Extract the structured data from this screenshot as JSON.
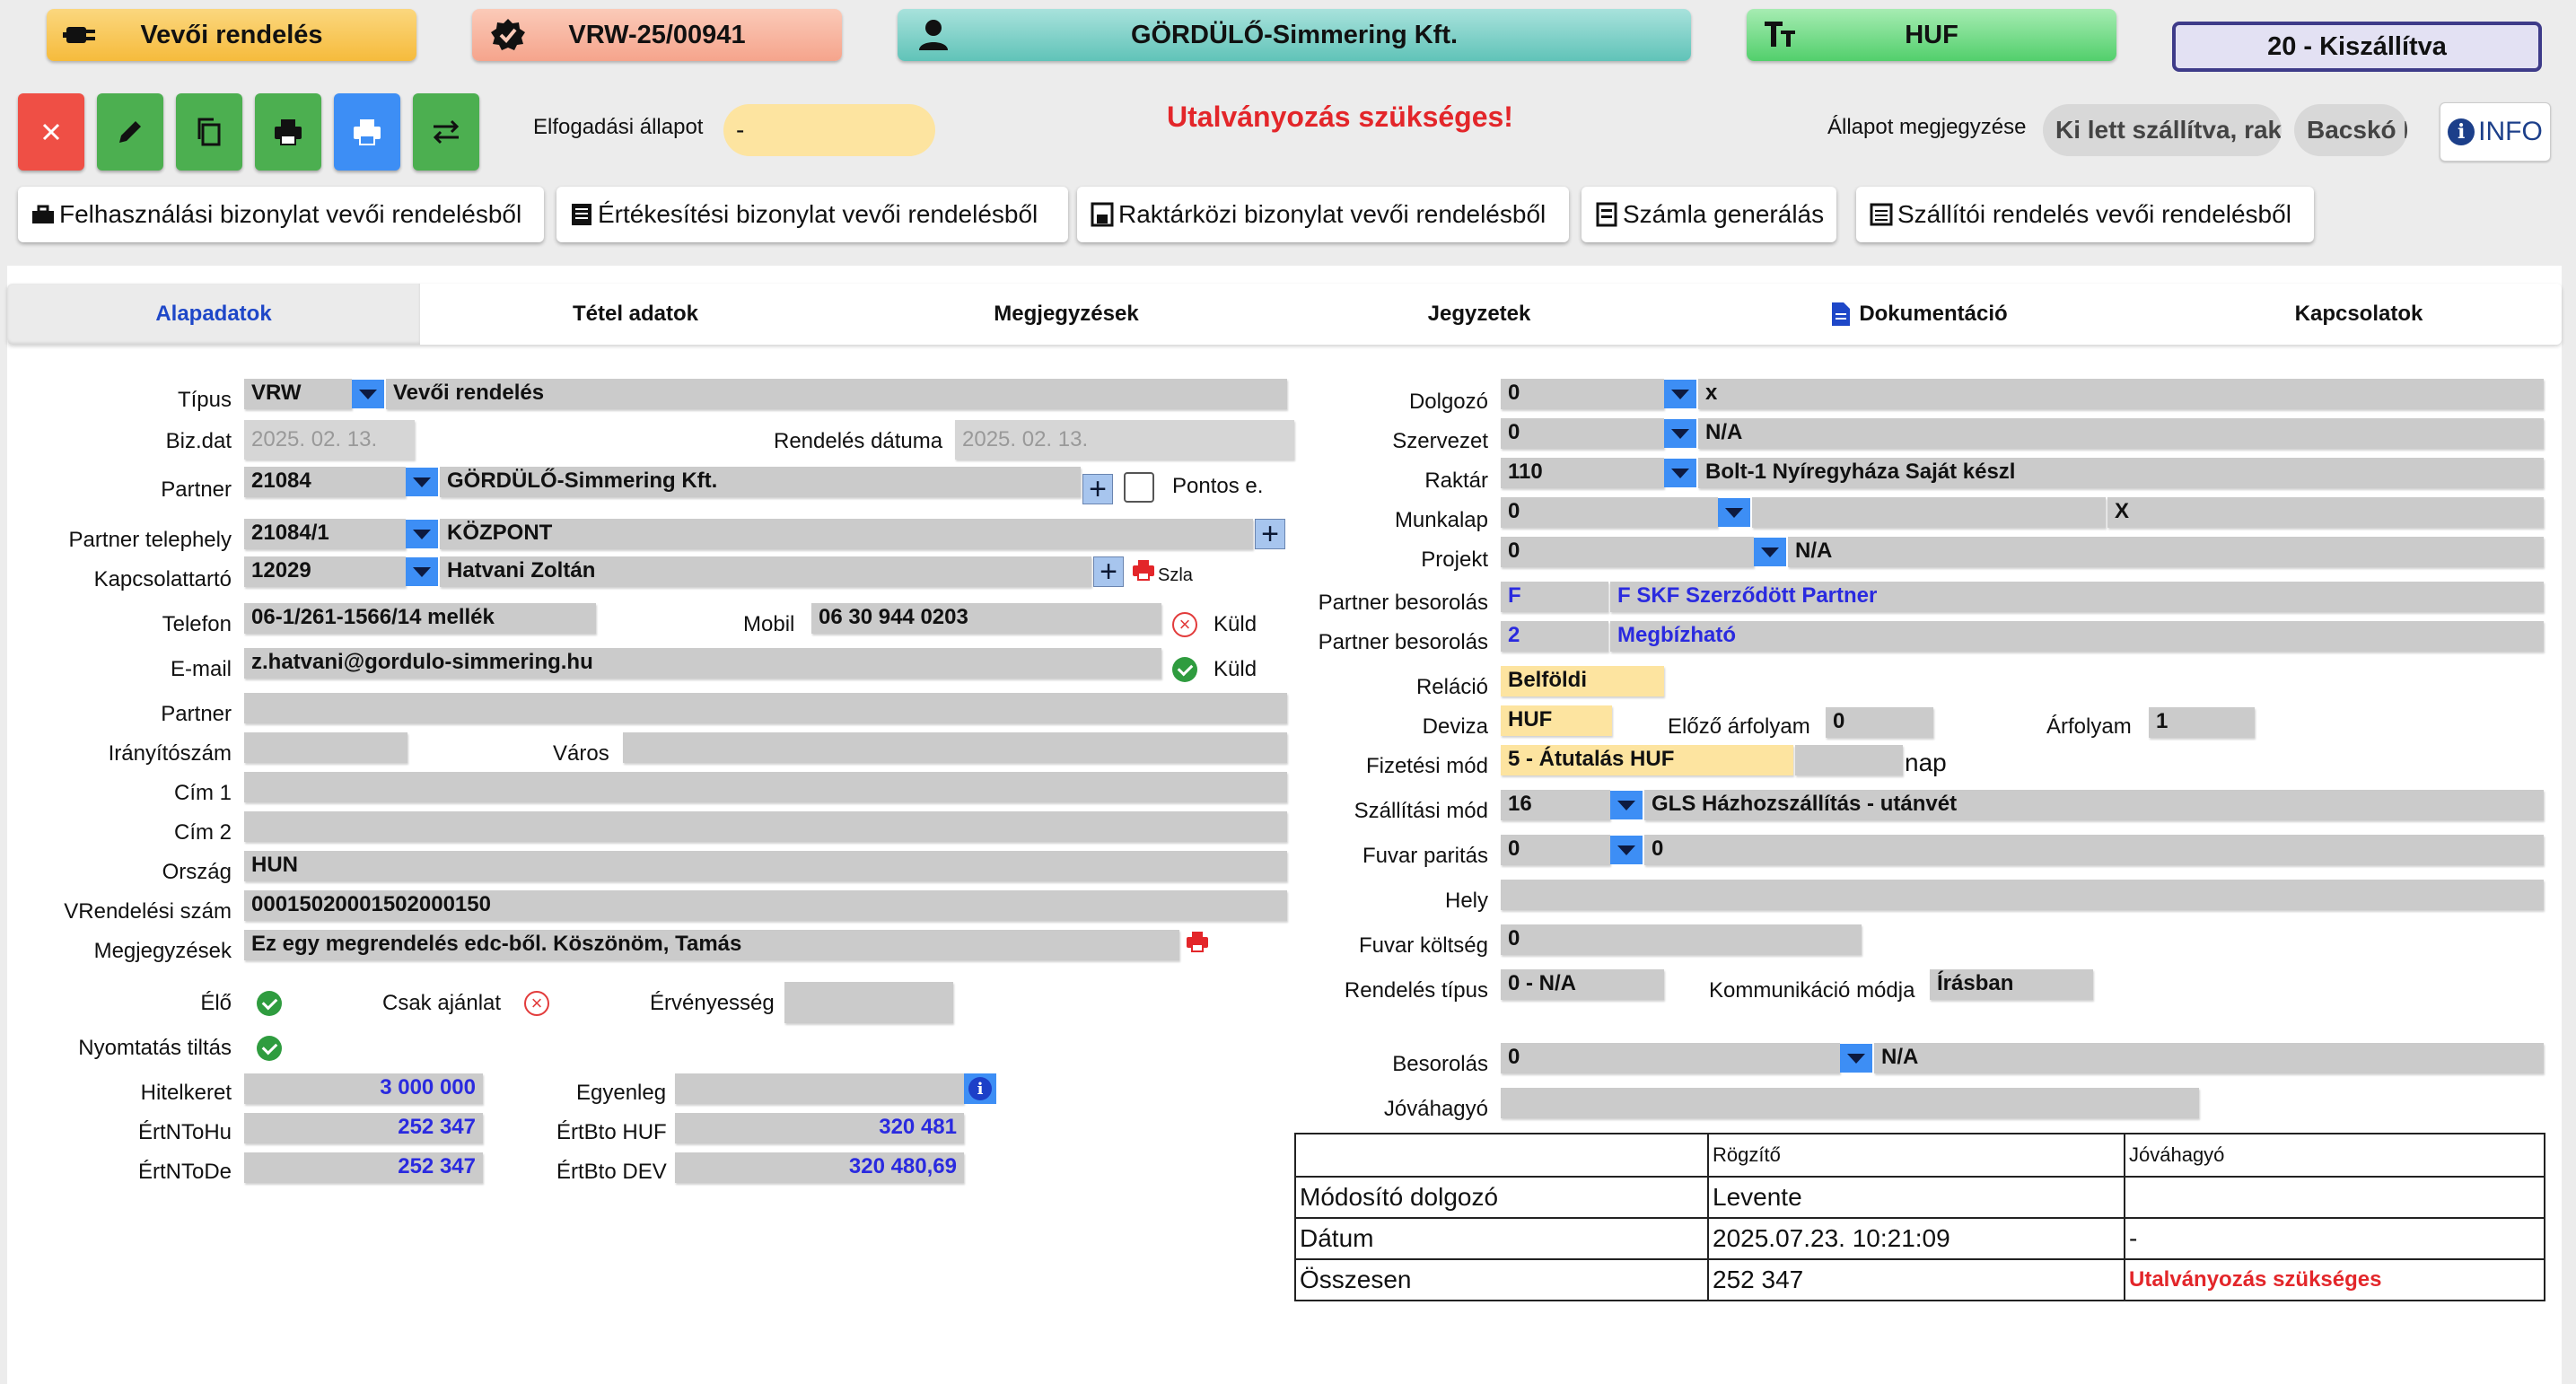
{
  "header": {
    "type_label": "Vevői rendelés",
    "doc_number": "VRW-25/00941",
    "partner_name": "GÖRDÜLŐ-Simmering Kft.",
    "currency": "HUF",
    "status": "20 - Kiszállítva"
  },
  "toolbar": {
    "acceptance_label": "Elfogadási állapot",
    "acceptance_value": "-",
    "warning": "Utalványozás szükséges!",
    "status_note_label": "Állapot megjegyzése",
    "status_note_value": "Ki lett szállítva, raktárból",
    "status_note_user": "Bacskó Levente",
    "info_label": "INFO",
    "actions": [
      "Felhasználási bizonylat vevői rendelésből",
      "Értékesítési bizonylat vevői rendelésből",
      "Raktárközi bizonylat vevői rendelésből",
      "Számla generálás",
      "Szállítói rendelés vevői rendelésből"
    ]
  },
  "tabs": [
    "Alapadatok",
    "Tétel adatok",
    "Megjegyzések",
    "Jegyzetek",
    "Dokumentáció",
    "Kapcsolatok"
  ],
  "left": {
    "tipus_label": "Típus",
    "tipus_code": "VRW",
    "tipus_name": "Vevői rendelés",
    "bizdat_label": "Biz.dat",
    "bizdat": "2025. 02. 13.",
    "rend_datum_label": "Rendelés dátuma",
    "rend_datum": "2025. 02. 13.",
    "partner_label": "Partner",
    "partner_code": "21084",
    "partner_name": "GÖRDÜLŐ-Simmering Kft.",
    "pontos_label": "Pontos e.",
    "telephely_label": "Partner telephely",
    "telephely_code": "21084/1",
    "telephely_name": "KÖZPONT",
    "kapcs_label": "Kapcsolattartó",
    "kapcs_code": "12029",
    "kapcs_name": "Hatvani Zoltán",
    "szla_label": "Szla",
    "telefon_label": "Telefon",
    "telefon": "06-1/261-1566/14 mellék",
    "mobil_label": "Mobil",
    "mobil": "06 30 944 0203",
    "kuld_label": "Küld",
    "email_label": "E-mail",
    "email": "z.hatvani@gordulo-simmering.hu",
    "partner2_label": "Partner",
    "partner2": "",
    "irsz_label": "Irányítószám",
    "irsz": "",
    "varos_label": "Város",
    "varos": "",
    "cim1_label": "Cím 1",
    "cim1": "",
    "cim2_label": "Cím 2",
    "cim2": "",
    "orszag_label": "Ország",
    "orszag": "HUN",
    "vrend_label": "VRendelési szám",
    "vrend": "00015020001502000150",
    "megj_label": "Megjegyzések",
    "megj": "Ez egy megrendelés edc-ből. Köszönöm, Tamás",
    "elo_label": "Élő",
    "csak_ajanlat_label": "Csak ajánlat",
    "ervenyesseg_label": "Érvényesség",
    "nyomtatas_label": "Nyomtatás tiltás",
    "hitelkeret_label": "Hitelkeret",
    "hitelkeret": "3 000 000",
    "egyenleg_label": "Egyenleg",
    "egyenleg": "",
    "ertntohu_label": "ÉrtNToHu",
    "ertntohu": "252 347",
    "ertbtohuf_label": "ÉrtBto HUF",
    "ertbtohuf": "320 481",
    "ertntode_label": "ÉrtNToDe",
    "ertntode": "252 347",
    "ertbtodev_label": "ÉrtBto DEV",
    "ertbtodev": "320 480,69"
  },
  "right": {
    "dolgozo_label": "Dolgozó",
    "dolgozo_code": "0",
    "dolgozo_name": "x",
    "szervezet_label": "Szervezet",
    "szervezet_code": "0",
    "szervezet_name": "N/A",
    "raktar_label": "Raktár",
    "raktar_code": "110",
    "raktar_name": "Bolt-1 Nyíregyháza Saját készl",
    "munkalap_label": "Munkalap",
    "munkalap_code": "0",
    "munkalap_name": "X",
    "projekt_label": "Projekt",
    "projekt_code": "0",
    "projekt_name": "N/A",
    "besorolas1_label": "Partner besorolás",
    "besorolas1_code": "F",
    "besorolas1_name": "F SKF Szerződött Partner",
    "besorolas2_label": "Partner besorolás",
    "besorolas2_code": "2",
    "besorolas2_name": "Megbízható",
    "relacio_label": "Reláció",
    "relacio": "Belföldi",
    "deviza_label": "Deviza",
    "deviza": "HUF",
    "elozo_label": "Előző árfolyam",
    "elozo": "0",
    "arfolyam_label": "Árfolyam",
    "arfolyam": "1",
    "fizmod_label": "Fizetési mód",
    "fizmod": "5 - Átutalás HUF",
    "nap_label": "nap",
    "szallmod_label": "Szállítási mód",
    "szallmod_code": "16",
    "szallmod_name": "GLS Házhozszállítás - utánvét",
    "fuvar_label": "Fuvar paritás",
    "fuvar_code": "0",
    "fuvar_name": "0",
    "hely_label": "Hely",
    "hely": "",
    "fuvark_label": "Fuvar költség",
    "fuvark": "0",
    "rendtip_label": "Rendelés típus",
    "rendtip": "0 - N/A",
    "komm_label": "Kommunikáció módja",
    "komm": "Írásban",
    "besorolas_label": "Besorolás",
    "besorolas_code": "0",
    "besorolas_name": "N/A",
    "jovahagyo_label": "Jóváhagyó",
    "jovahagyo": ""
  },
  "summary": {
    "col_rogzito": "Rögzítő",
    "col_jovahagyo": "Jóváhagyó",
    "rows": [
      {
        "label": "Módosító dolgozó",
        "rogzito": "Levente",
        "jovahagyo": ""
      },
      {
        "label": "Dátum",
        "rogzito": "2025.07.23. 10:21:09",
        "jovahagyo": "-"
      },
      {
        "label": "Összesen",
        "rogzito": "252 347",
        "jovahagyo": "Utalványozás szükséges"
      }
    ]
  },
  "colors": {
    "accent_blue": "#3d8ef5",
    "warning_red": "#e3262a",
    "ok_green": "#2f9c3f",
    "status_border": "#3e3b89",
    "field_gray": "#cbcbcb",
    "field_yellow": "#fde4a0"
  },
  "icons": [
    "plug-icon",
    "check-badge-icon",
    "person-icon",
    "text-format-icon",
    "close-icon",
    "pencil-icon",
    "copy-icon",
    "printer-icon",
    "swap-icon",
    "info-icon",
    "document-icon",
    "print-small-icon"
  ]
}
